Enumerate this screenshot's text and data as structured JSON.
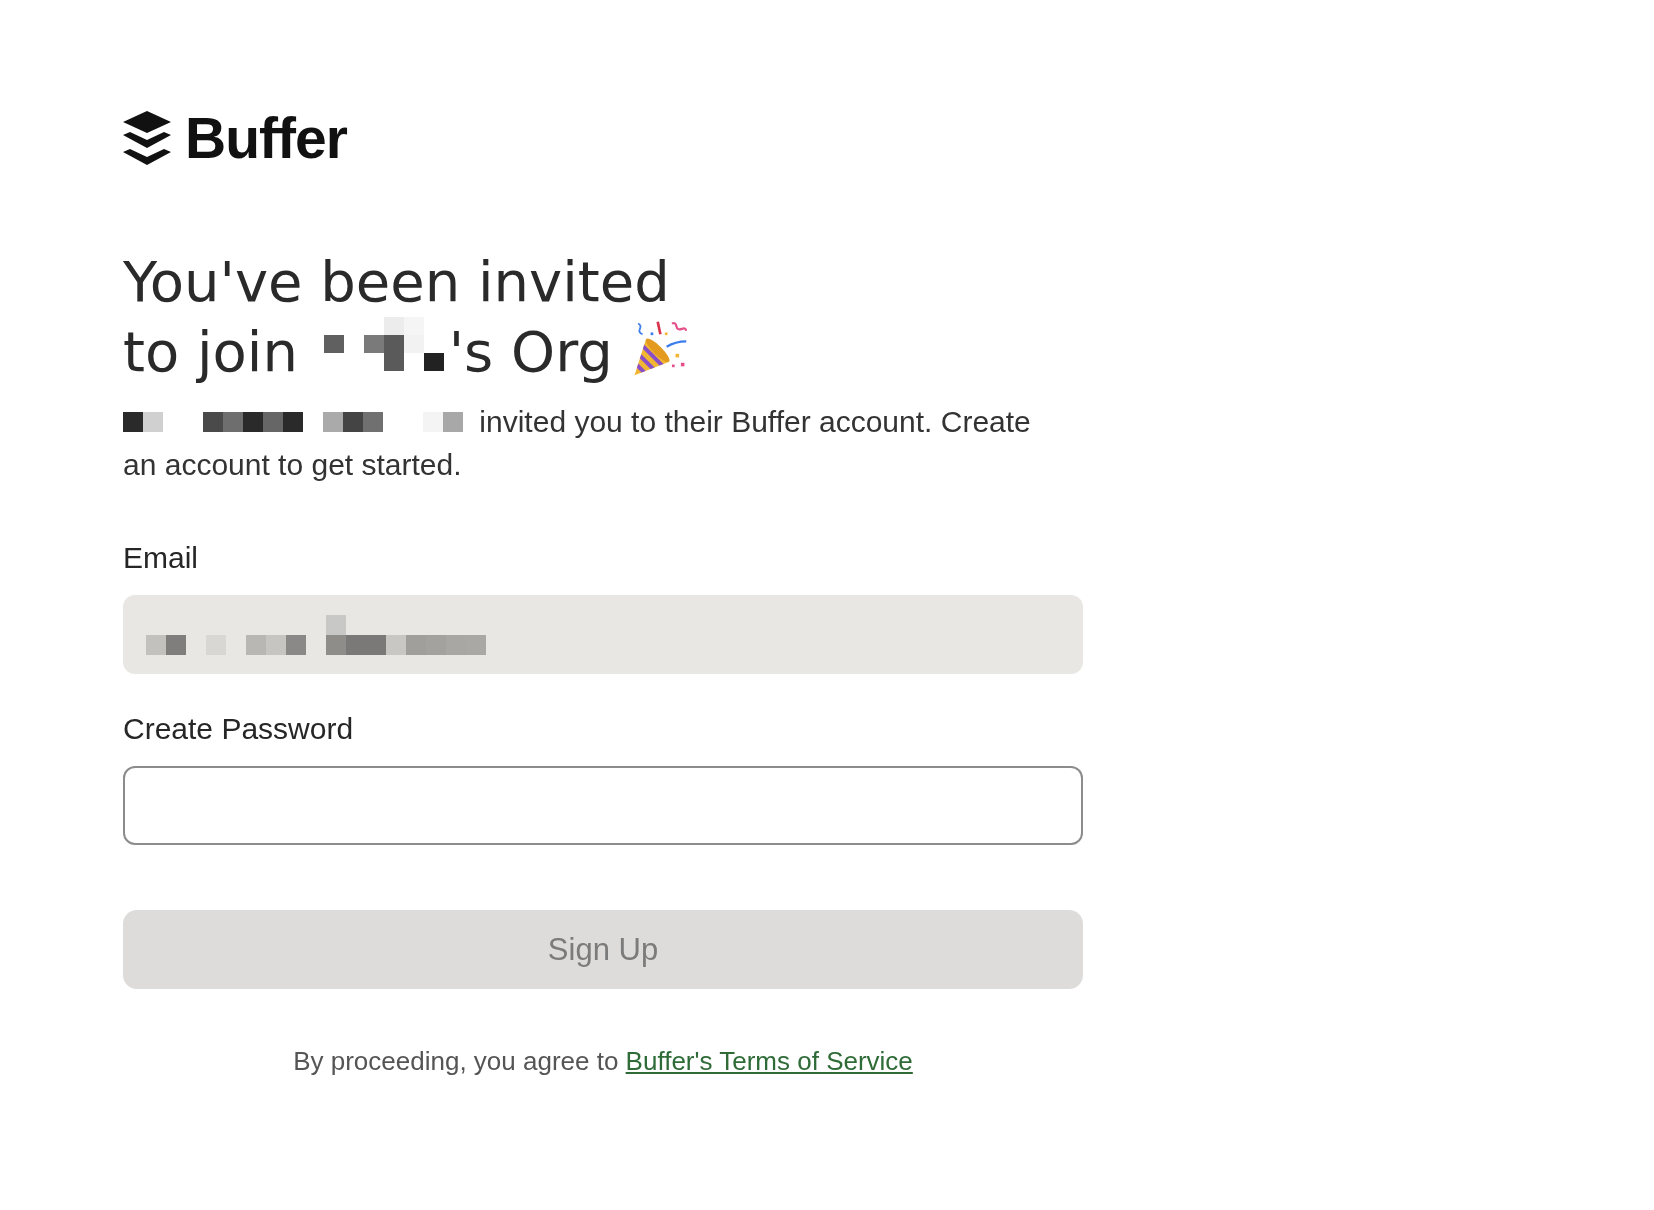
{
  "logo": {
    "wordmark": "Buffer"
  },
  "heading": {
    "line_1": "You've been invited",
    "prefix": "to join",
    "name_pixelated": true,
    "suffix": "'s Org"
  },
  "invitation": {
    "name_pixelated": true,
    "text": "invited you to their Buffer account. Create an account to get started."
  },
  "email": {
    "label": "Email",
    "value_pixelated": true,
    "disabled": true
  },
  "password": {
    "label": "Create Password",
    "disabled": false
  },
  "sign_up": {
    "label": "Sign Up",
    "disabled": true
  },
  "terms": {
    "text": "By proceeding, you agree to",
    "link": "Buffer's Terms of Service"
  }
}
